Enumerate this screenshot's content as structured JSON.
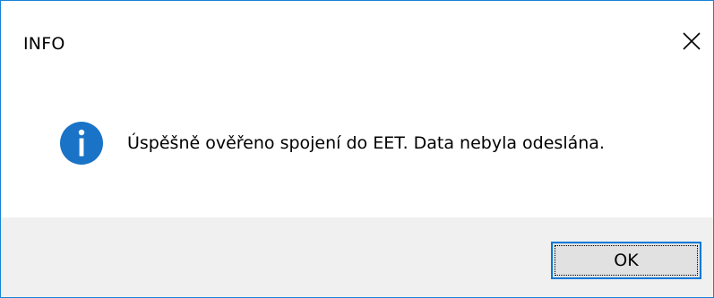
{
  "window": {
    "title": "INFO"
  },
  "message": {
    "text": "Úspěšně ověřeno spojení do EET. Data nebyla odeslána.",
    "icon": "info-icon"
  },
  "buttons": {
    "ok_label": "OK",
    "close_icon": "close-icon"
  },
  "colors": {
    "border": "#1883d7",
    "info_icon": "#1a73c6",
    "footer_bg": "#f0f0f0",
    "button_bg": "#e1e1e1",
    "button_border": "#0078d7"
  }
}
